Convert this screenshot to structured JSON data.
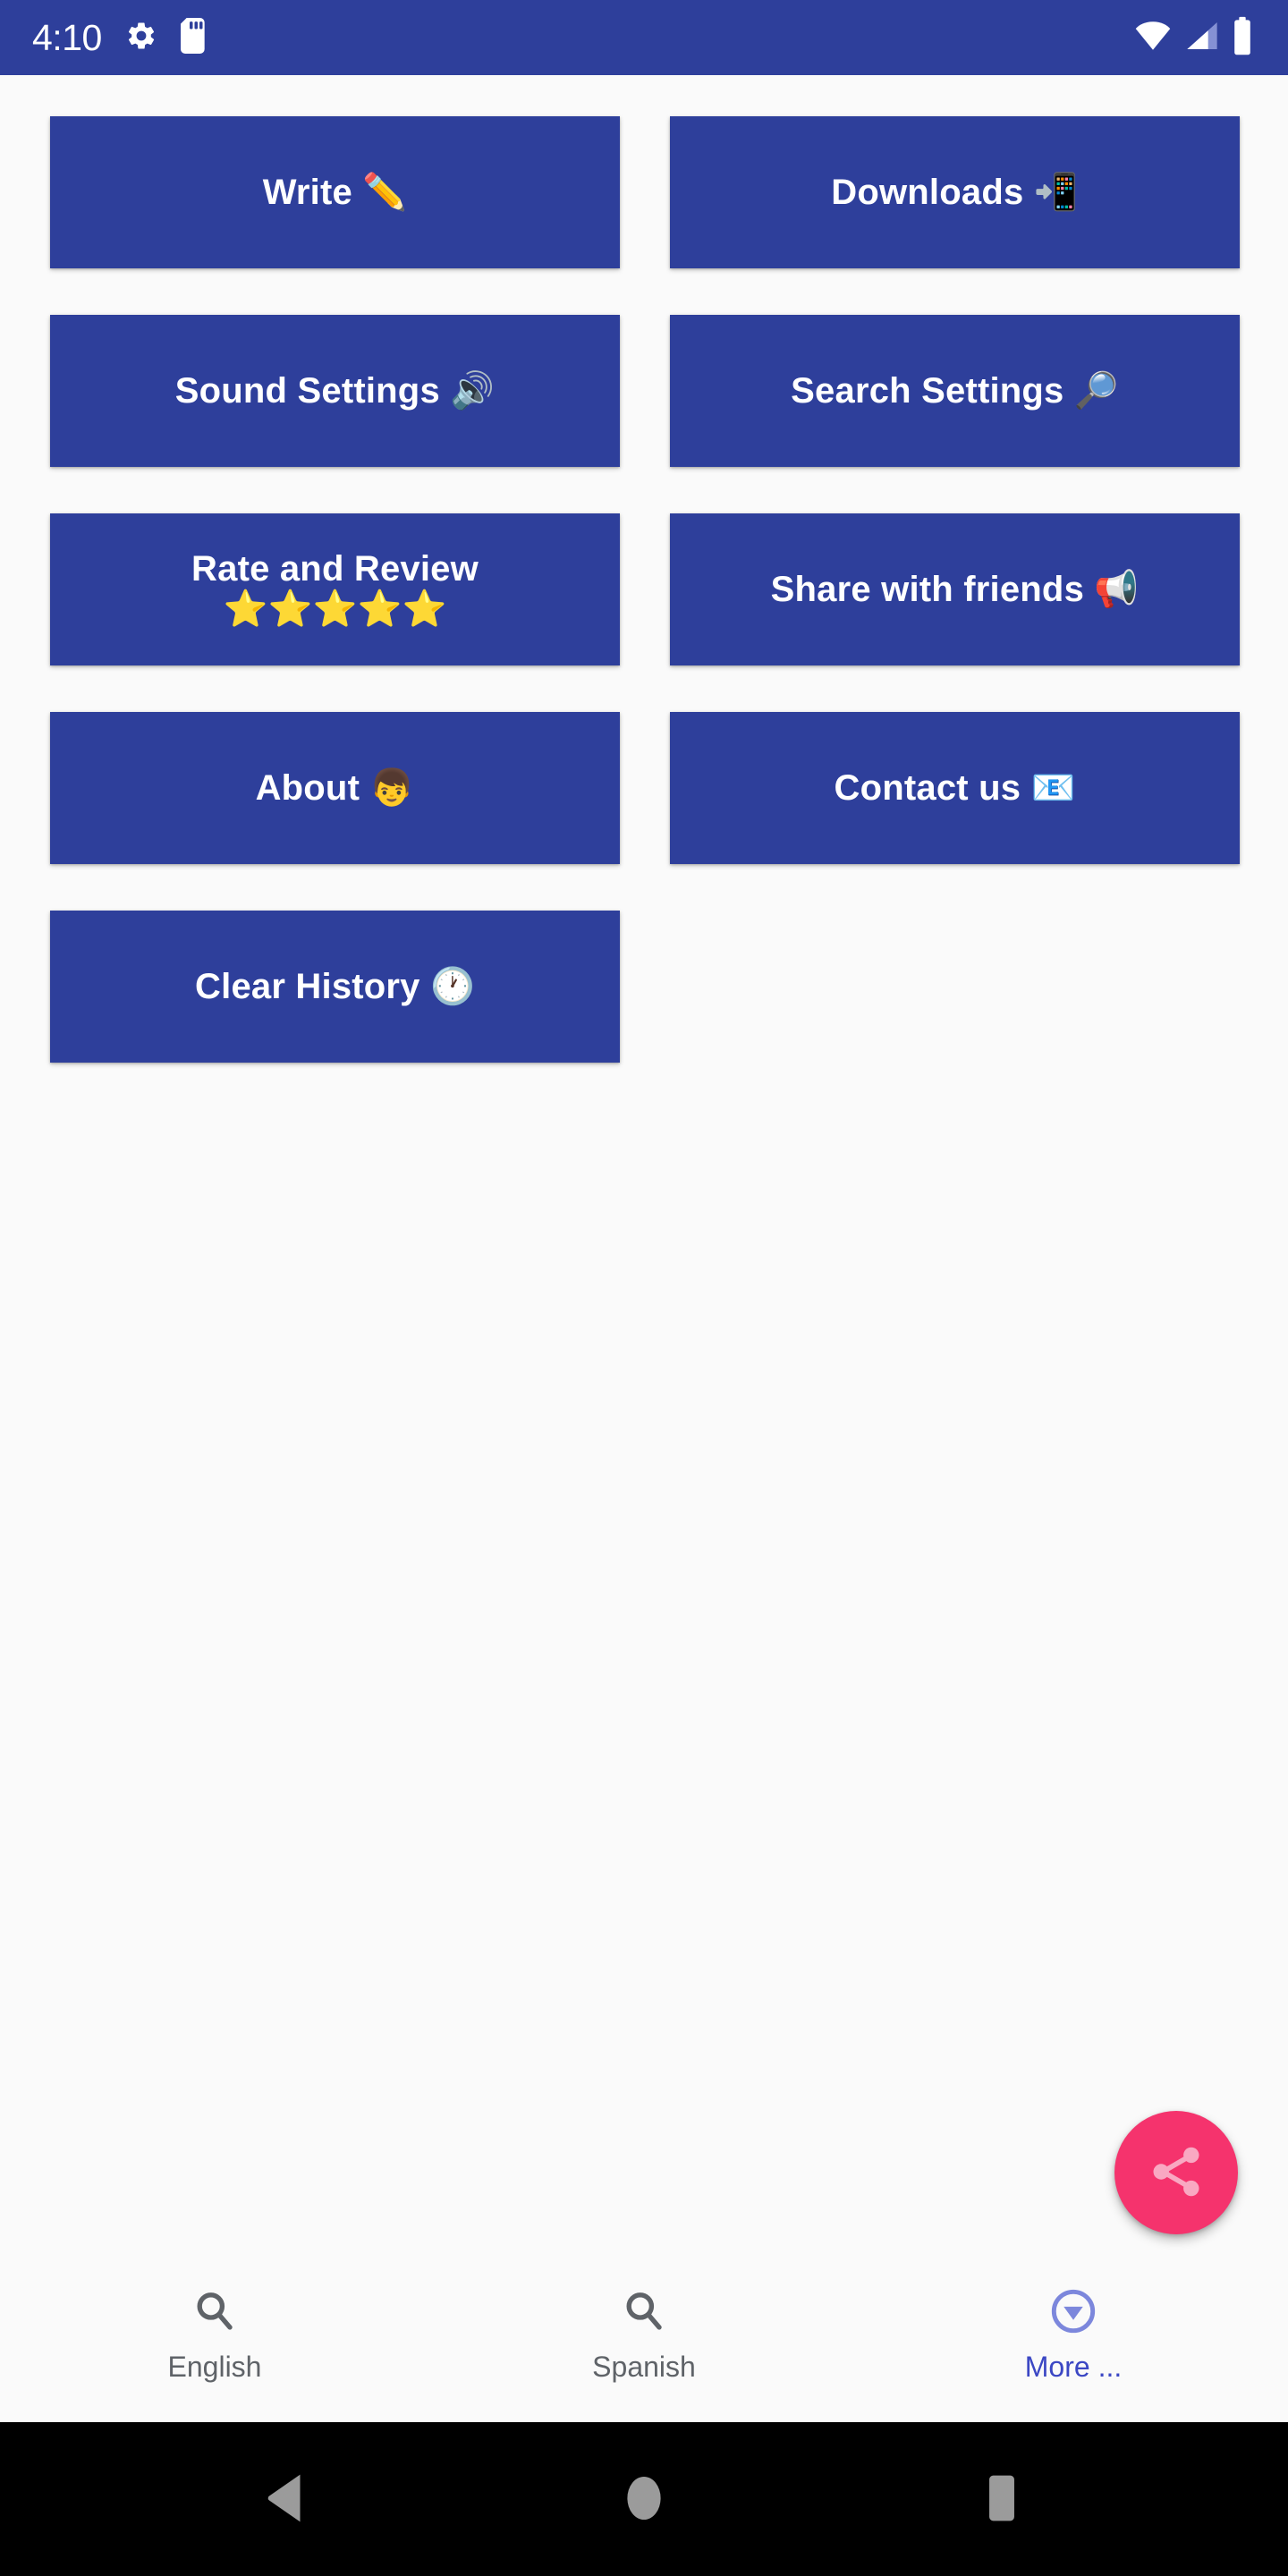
{
  "status_bar": {
    "time": "4:10",
    "background_color": "#2E3F9B",
    "icons": [
      "gear-icon",
      "sd-card-icon",
      "wifi-icon",
      "cellular-signal-icon",
      "battery-icon"
    ]
  },
  "theme": {
    "button_color": "#2E3F9B",
    "page_background": "#FAFAFA",
    "fab_color": "#F5336D",
    "active_nav_color": "#3B47C4",
    "inactive_nav_color": "#5F6368"
  },
  "grid_buttons": [
    {
      "label": "Write ✏️",
      "icon": "pencil-emoji",
      "name": "write-button"
    },
    {
      "label": "Downloads 📲",
      "icon": "mobile-arrow-emoji",
      "name": "downloads-button"
    },
    {
      "label": "Sound Settings 🔊",
      "icon": "speaker-emoji",
      "name": "sound-settings-button"
    },
    {
      "label": "Search Settings 🔎",
      "icon": "magnifier-emoji",
      "name": "search-settings-button"
    },
    {
      "label": "Rate and Review\n⭐⭐⭐⭐⭐",
      "icon": "stars-emoji",
      "name": "rate-and-review-button"
    },
    {
      "label": "Share with friends 📢",
      "icon": "megaphone-emoji",
      "name": "share-with-friends-button"
    },
    {
      "label": "About 👦",
      "icon": "boy-emoji",
      "name": "about-button"
    },
    {
      "label": "Contact us 📧",
      "icon": "envelope-emoji",
      "name": "contact-us-button"
    },
    {
      "label": "Clear History 🕐",
      "icon": "clock-emoji",
      "name": "clear-history-button"
    }
  ],
  "fab": {
    "icon": "share-icon",
    "color": "#F5336D"
  },
  "bottom_nav": {
    "items": [
      {
        "label": "English",
        "icon": "search-icon",
        "active": false
      },
      {
        "label": "Spanish",
        "icon": "search-icon",
        "active": false
      },
      {
        "label": "More ...",
        "icon": "circle-chevron-down-icon",
        "active": true
      }
    ]
  },
  "system_nav": {
    "items": [
      {
        "name": "back-button",
        "icon": "triangle-left-icon"
      },
      {
        "name": "home-button",
        "icon": "circle-icon"
      },
      {
        "name": "recents-button",
        "icon": "square-icon"
      }
    ]
  }
}
